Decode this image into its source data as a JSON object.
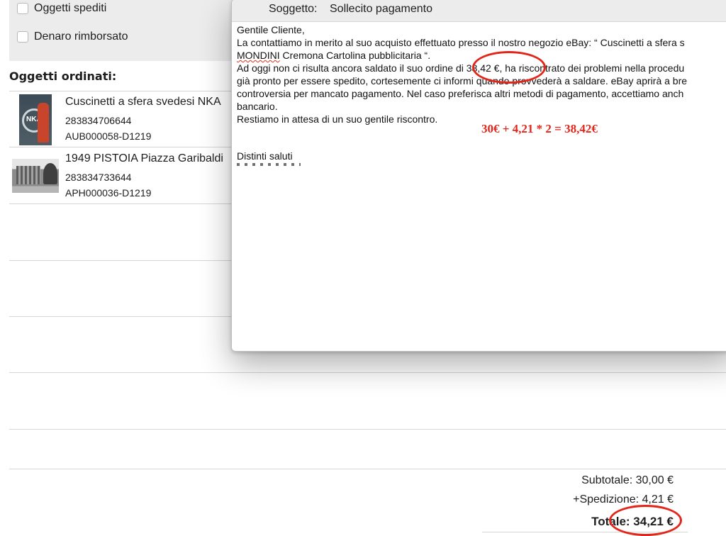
{
  "order": {
    "filters": [
      {
        "label": "Oggetti spediti",
        "checked": false
      },
      {
        "label": "Denaro rimborsato",
        "checked": false
      }
    ],
    "section_title": "Oggetti ordinati:",
    "items": [
      {
        "title": "Cuscinetti a sfera svedesi NKA",
        "item_id": "283834706644",
        "sku": "AUB000058-D1219",
        "thumb_text": "NKA"
      },
      {
        "title": "1949 PISTOIA Piazza Garibaldi",
        "item_id": "283834733644",
        "sku": "APH000036-D1219"
      }
    ],
    "totals": {
      "subtotal": "Subtotale: 30,00 €",
      "shipping": "+Spedizione: 4,21 €",
      "total": "Totale: 34,21 €"
    }
  },
  "compose": {
    "subject_label": "Soggetto:",
    "subject_value": "Sollecito pagamento",
    "body": {
      "greeting": "Gentile Cliente,",
      "line1": "La contattiamo in merito al suo acquisto effettuato presso il nostro negozio eBay: “ Cuscinetti a sfera s",
      "line2_word": "MONDINI",
      "line2_rest": " Cremona Cartolina pubblicitaria “.",
      "line3": "Ad oggi non ci risulta ancora saldato il suo ordine di 38,42 €, ha riscontrato dei problemi nella procedu",
      "line4": "già pronto per essere spedito, cortesemente ci informi quando provvederà a saldare. eBay aprirà a bre",
      "line5": "controversia per mancato pagamento. Nel caso preferisca altri metodi di pagamento, accettiamo anch",
      "line6": "bancario.",
      "line7": "Restiamo in attesa di un suo gentile riscontro.",
      "closing": "Distinti saluti"
    },
    "annotation_formula": "30€ + 4,21 * 2 = 38,42€"
  },
  "colors": {
    "annotation_red": "#e3261a",
    "filter_panel": "#ececec"
  }
}
